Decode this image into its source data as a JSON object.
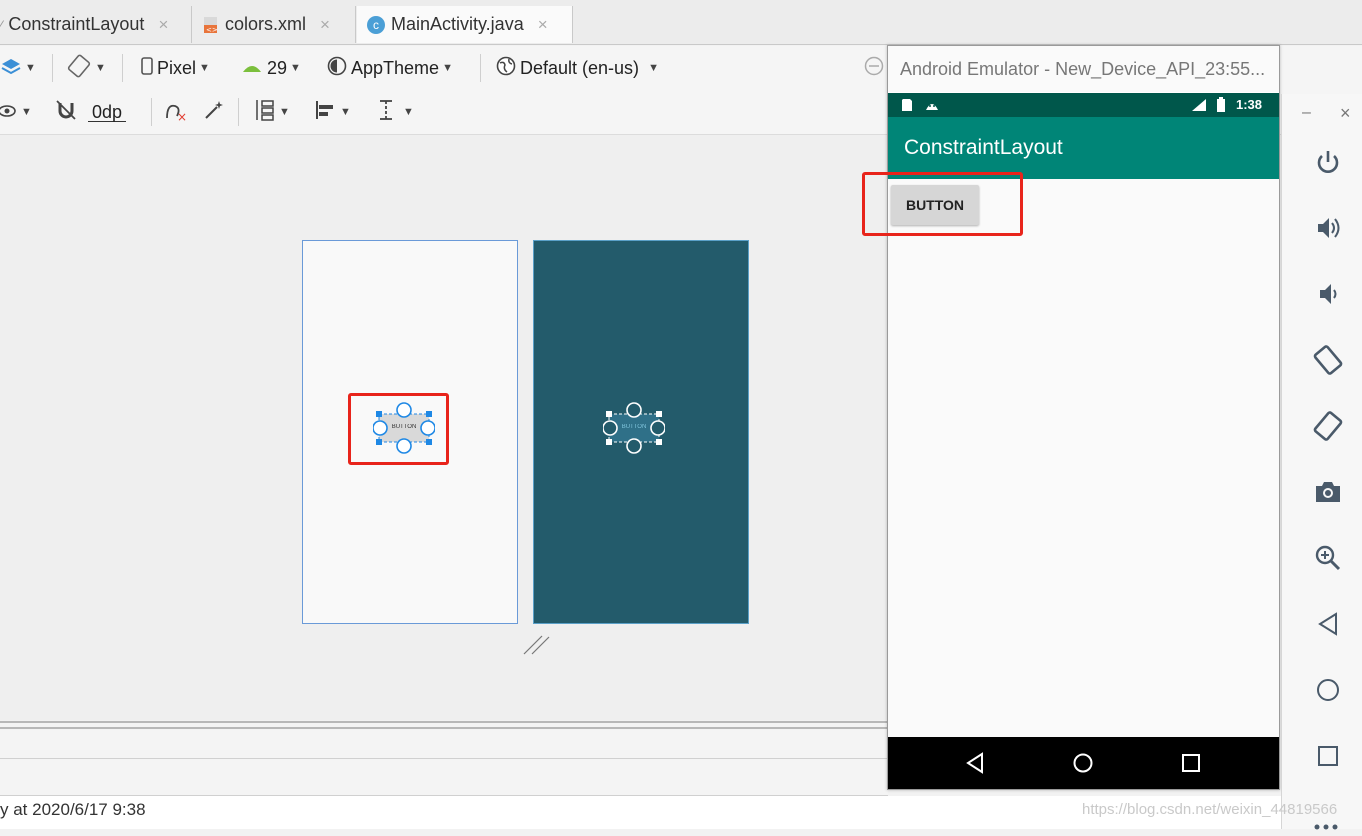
{
  "tabs": [
    {
      "label": "ConstraintLayout",
      "close": "×",
      "icon": "layout-file-icon"
    },
    {
      "label": "colors.xml",
      "close": "×",
      "icon": "xml-file-icon"
    },
    {
      "label": "MainActivity.java",
      "close": "×",
      "icon": "java-class-icon",
      "icon_letter": "c"
    }
  ],
  "toolbar": {
    "device": "Pixel",
    "api_level": "29",
    "theme": "AppTheme",
    "locale": "Default (en-us)",
    "margin": "0dp"
  },
  "design": {
    "button_text": "BUTTON"
  },
  "emulator": {
    "window_title": "Android Emulator - New_Device_API_23:55...",
    "status_time": "1:38",
    "app_title": "ConstraintLayout",
    "button_label": "BUTTON",
    "window_controls": {
      "minimize": "–",
      "close": "×"
    }
  },
  "status": {
    "text": "y at 2020/6/17 9:38"
  },
  "watermark": "https://blog.csdn.net/weixin_44819566",
  "colors": {
    "highlight": "#e8241b",
    "blueprint": "#235b6b",
    "app_bar": "#008577",
    "status_bar": "#00574b"
  }
}
